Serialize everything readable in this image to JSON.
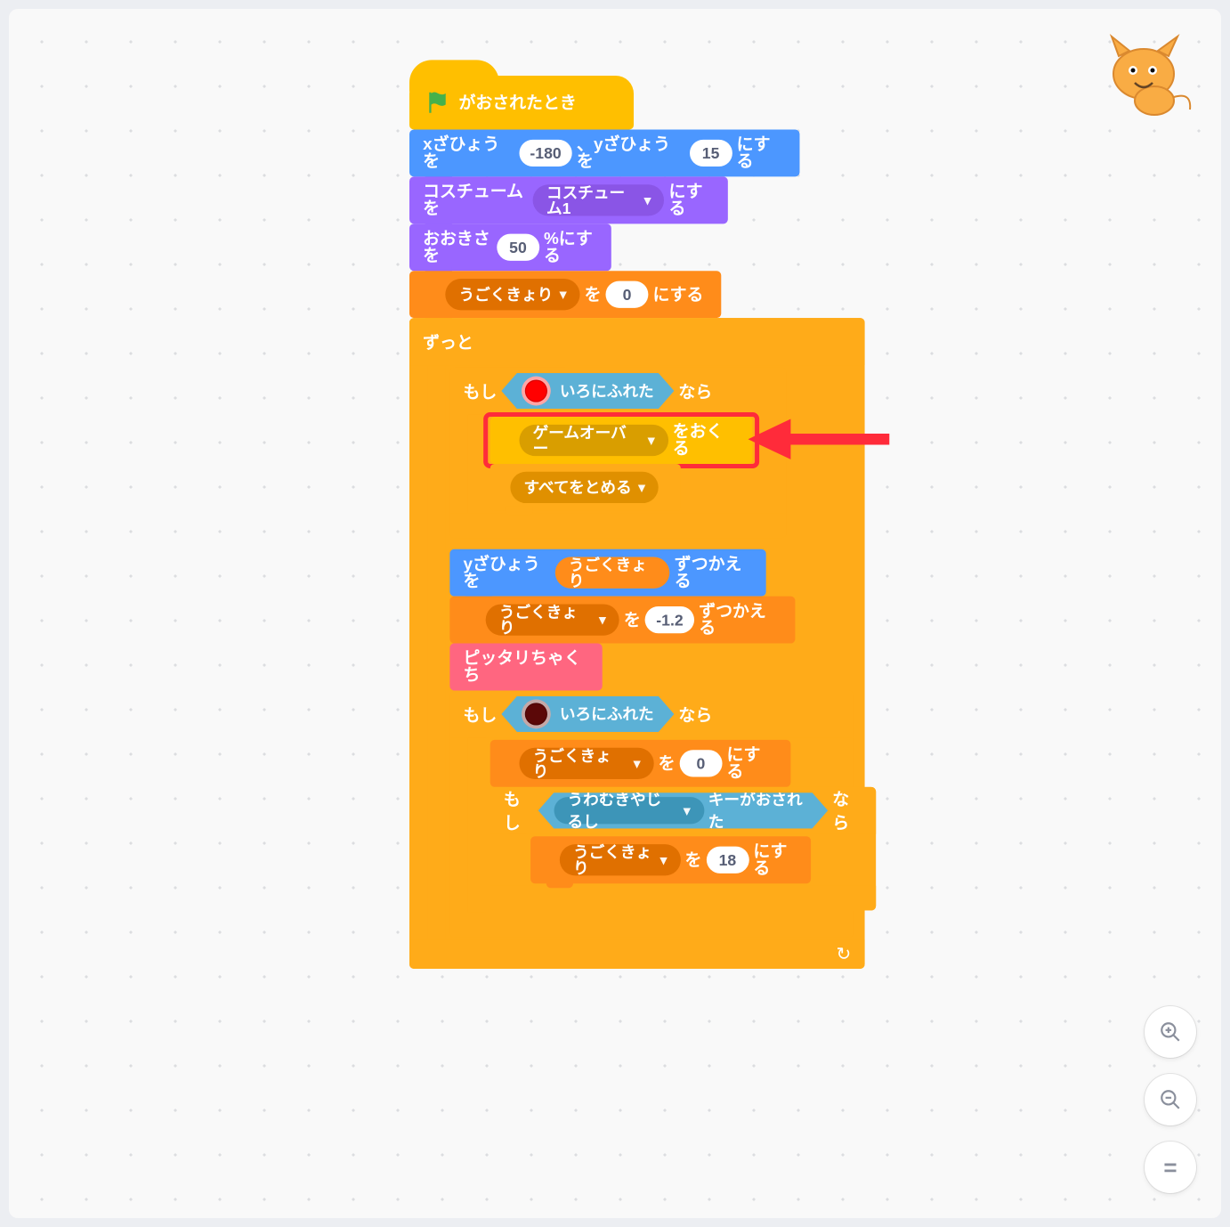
{
  "hat": {
    "label": "がおされたとき"
  },
  "goto": {
    "pre": "xざひょうを",
    "x": "-180",
    "mid": "、yざひょうを",
    "y": "15",
    "post": "にする"
  },
  "costume": {
    "pre": "コスチュームを",
    "dd": "コスチューム1",
    "post": "にする"
  },
  "size": {
    "pre": "おおきさを",
    "val": "50",
    "post": "%にする"
  },
  "setvar1": {
    "dd": "うごくきょり",
    "mid": "を",
    "val": "0",
    "post": "にする"
  },
  "forever": {
    "label": "ずっと"
  },
  "if1": {
    "pre": "もし",
    "touch_label": "いろにふれた",
    "post": "なら",
    "color": "#ff0000"
  },
  "broadcast": {
    "dd": "ゲームオーバー",
    "post": "をおくる"
  },
  "stop": {
    "dd": "すべてをとめる"
  },
  "changey": {
    "pre": "yざひょうを",
    "var_label": "うごくきょり",
    "post": "ずつかえる"
  },
  "changevar": {
    "dd": "うごくきょり",
    "mid": "を",
    "val": "-1.2",
    "post": "ずつかえる"
  },
  "myblock": {
    "label": "ピッタリちゃくち"
  },
  "if2": {
    "pre": "もし",
    "touch_label": "いろにふれた",
    "post": "なら",
    "color": "#5b0808"
  },
  "setvar2": {
    "dd": "うごくきょり",
    "mid": "を",
    "val": "0",
    "post": "にする"
  },
  "if3": {
    "pre": "もし",
    "key_dd": "うわむきやじるし",
    "key_post": "キーがおされた",
    "post": "なら"
  },
  "setvar3": {
    "dd": "うごくきょり",
    "mid": "を",
    "val": "18",
    "post": "にする"
  },
  "zoom": {
    "in": "+",
    "out": "−",
    "reset": "="
  }
}
